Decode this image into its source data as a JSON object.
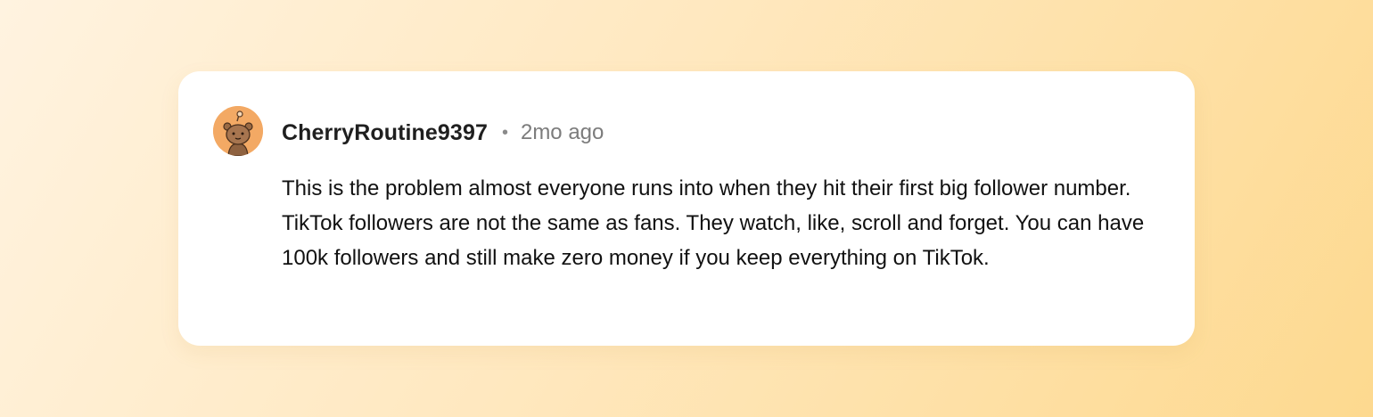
{
  "comment": {
    "author": "CherryRoutine9397",
    "separator": "•",
    "time_ago": "2mo ago",
    "text": "This is the problem almost everyone runs into when they hit their first big follower number. TikTok followers are not the same as fans. They watch, like, scroll and forget. You can have 100k followers and still make zero money if you keep everything on TikTok.",
    "avatar_icon": "snoo-avatar-icon"
  },
  "colors": {
    "avatar_bg": "#f3a964",
    "card_bg": "#ffffff",
    "text": "#111111",
    "meta_text": "#7c7c7c"
  }
}
